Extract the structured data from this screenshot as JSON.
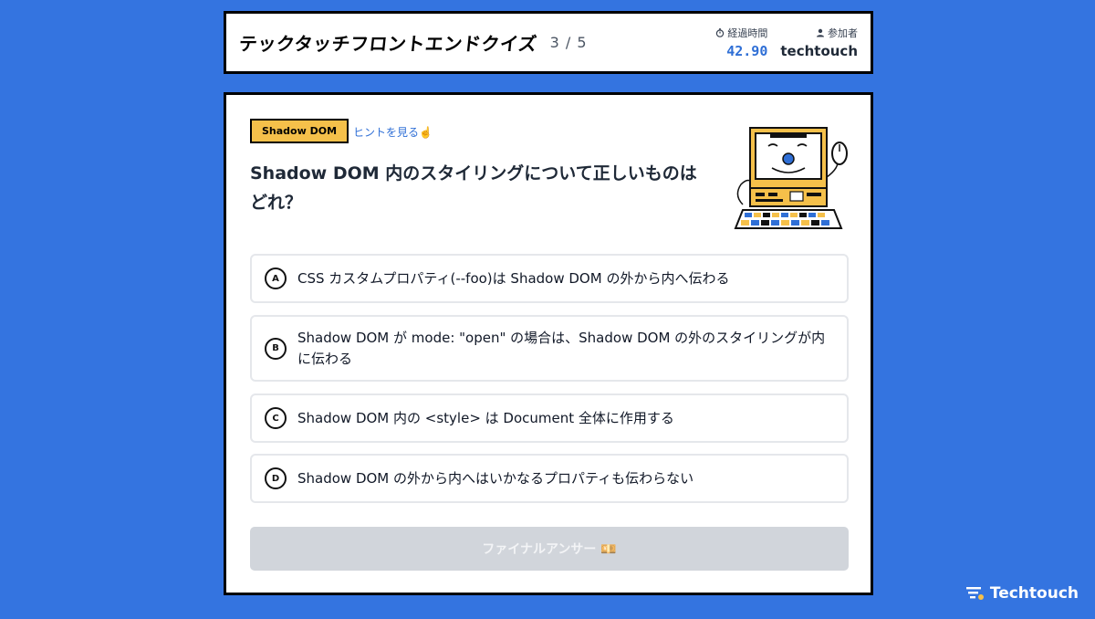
{
  "header": {
    "title": "テックタッチフロントエンドクイズ",
    "progress": "3 / 5",
    "time_label": "経過時間",
    "time_value": "42.90",
    "user_label": "参加者",
    "user_value": "techtouch"
  },
  "question": {
    "tag": "Shadow DOM",
    "hint": "ヒントを見る☝️",
    "text": "Shadow DOM 内のスタイリングについて正しいものはどれ？"
  },
  "options": [
    {
      "letter": "A",
      "text": "CSS カスタムプロパティ(--foo)は Shadow DOM の外から内へ伝わる"
    },
    {
      "letter": "B",
      "text": "Shadow DOM が mode: \"open\" の場合は、Shadow DOM の外のスタイリングが内に伝わる"
    },
    {
      "letter": "C",
      "text": "Shadow DOM 内の <style> は Document 全体に作用する"
    },
    {
      "letter": "D",
      "text": "Shadow DOM の外から内へはいかなるプロパティも伝わらない"
    }
  ],
  "final_button": "ファイナルアンサー 💴",
  "brand": "Techtouch",
  "colors": {
    "background": "#3474e0",
    "tag": "#f5c04a",
    "accent": "#2f6fd6",
    "disabled": "#d1d5db"
  }
}
